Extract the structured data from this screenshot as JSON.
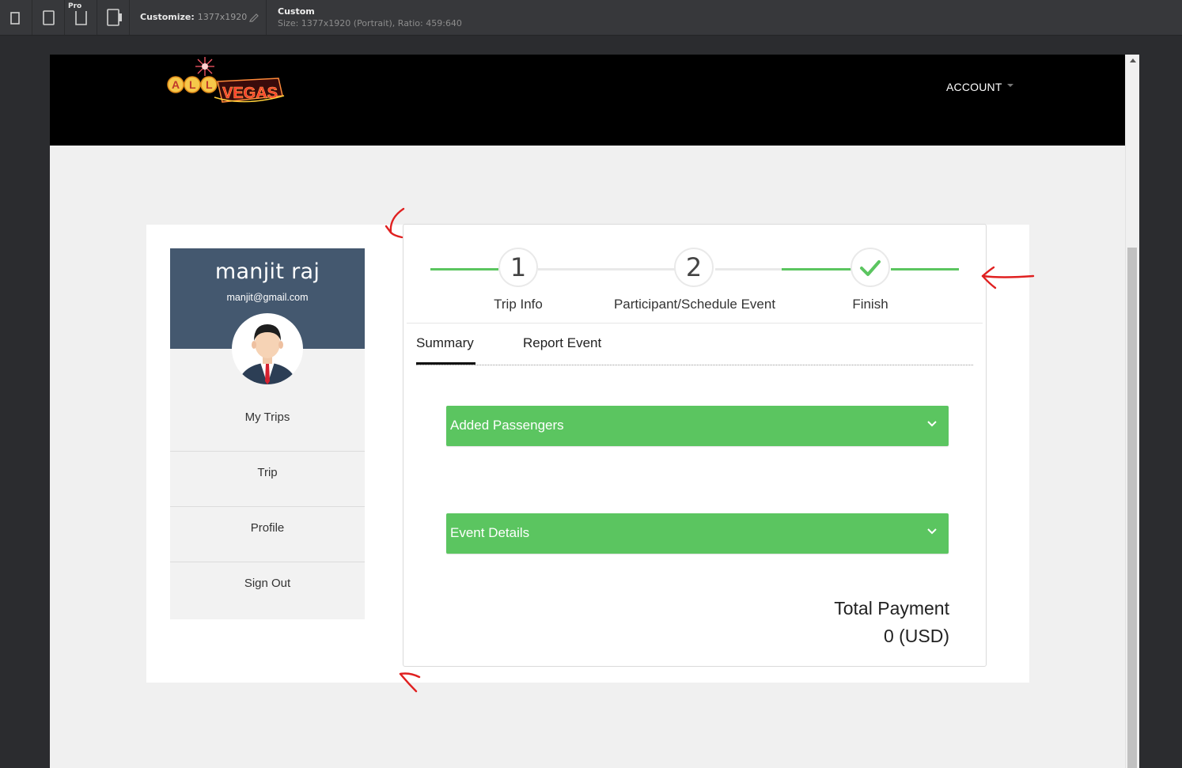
{
  "devtools": {
    "pro_badge": "Pro",
    "customize_label": "Customize:",
    "customize_value": "1377x1920",
    "custom_title": "Custom",
    "custom_size": "Size: 1377x1920 (Portrait), Ratio: 459:640",
    "icons": [
      "phone-portrait-icon",
      "tablet-icon",
      "laptop-icon",
      "rotate-device-icon",
      "pencil-icon"
    ]
  },
  "header": {
    "logo_text": "ALL VEGAS",
    "account_label": "ACCOUNT"
  },
  "profile": {
    "name": "manjit raj",
    "email": "manjit@gmail.com"
  },
  "sidebar": {
    "items": [
      {
        "label": "My Trips"
      },
      {
        "label": "Trip"
      },
      {
        "label": "Profile"
      },
      {
        "label": "Sign Out"
      }
    ]
  },
  "steps": [
    {
      "number": "1",
      "label": "Trip Info",
      "status": "pending"
    },
    {
      "number": "2",
      "label": "Participant/Schedule Event",
      "status": "pending"
    },
    {
      "number": "",
      "label": "Finish",
      "status": "complete"
    }
  ],
  "tabs": [
    {
      "label": "Summary",
      "active": true
    },
    {
      "label": "Report Event",
      "active": false
    }
  ],
  "accordions": [
    {
      "label": "Added Passengers"
    },
    {
      "label": "Event Details"
    }
  ],
  "total": {
    "label": "Total Payment",
    "value": "0 (USD)"
  },
  "colors": {
    "accent_green": "#5bc560",
    "profile_header": "#44586f",
    "annotation_red": "#e02020"
  }
}
